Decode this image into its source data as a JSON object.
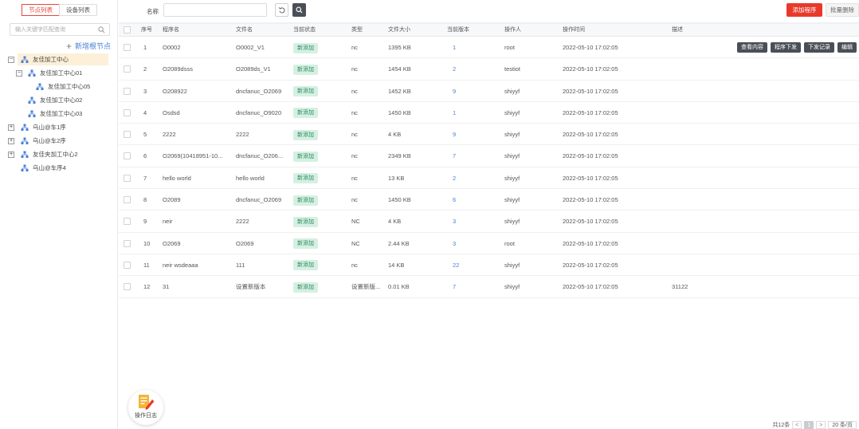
{
  "sidebar": {
    "tabs": [
      {
        "label": "节点列表",
        "active": true
      },
      {
        "label": "设备列表",
        "active": false
      }
    ],
    "search_placeholder": "输入关键字匹配查询",
    "add_root_label": "新增根节点",
    "tree": [
      {
        "label": "友佳加工中心",
        "toggle": "−",
        "selected": true
      },
      {
        "label": "友佳加工中心01",
        "toggle": "−"
      },
      {
        "label": "友佳加工中心05",
        "toggle": ""
      },
      {
        "label": "友佳加工中心02",
        "toggle": ""
      },
      {
        "label": "友佳加工中心03",
        "toggle": ""
      },
      {
        "label": "乌山@车1序",
        "toggle": "+"
      },
      {
        "label": "乌山@车2序",
        "toggle": "+"
      },
      {
        "label": "友佳夹加工中心2",
        "toggle": "+"
      },
      {
        "label": "乌山@车序4",
        "toggle": ""
      }
    ]
  },
  "toolbar": {
    "name_label": "名称",
    "name_value": "",
    "add_label": "添加程序",
    "batch_delete_label": "批量删除"
  },
  "table": {
    "headers": [
      "序号",
      "程序名",
      "文件名",
      "当前状态",
      "类型",
      "文件大小",
      "当前版本",
      "操作人",
      "操作时间",
      "描述"
    ],
    "row_actions": [
      "查看内容",
      "程序下发",
      "下发记录",
      "编辑"
    ],
    "rows": [
      {
        "no": "1",
        "program": "O0002",
        "file": "O0002_V1",
        "status": "新添加",
        "type": "nc",
        "size": "1395 KB",
        "version": "1",
        "operator": "root",
        "time": "2022-05-10 17:02:05",
        "desc": ""
      },
      {
        "no": "2",
        "program": "O2089dsss",
        "file": "O2089ds_V1",
        "status": "新添加",
        "type": "nc",
        "size": "1454 KB",
        "version": "2",
        "operator": "testiot",
        "time": "2022-05-10 17:02:05",
        "desc": ""
      },
      {
        "no": "3",
        "program": "O208922",
        "file": "dncfanuc_O2069",
        "status": "新添加",
        "type": "nc",
        "size": "1452 KB",
        "version": "9",
        "operator": "shiyyf",
        "time": "2022-05-10 17:02:05",
        "desc": ""
      },
      {
        "no": "4",
        "program": "Osdsd",
        "file": "dncfanuc_O9020",
        "status": "新添加",
        "type": "nc",
        "size": "1450 KB",
        "version": "1",
        "operator": "shiyyf",
        "time": "2022-05-10 17:02:05",
        "desc": ""
      },
      {
        "no": "5",
        "program": "2222",
        "file": "2222",
        "status": "新添加",
        "type": "nc",
        "size": "4 KB",
        "version": "9",
        "operator": "shiyyf",
        "time": "2022-05-10 17:02:05",
        "desc": ""
      },
      {
        "no": "6",
        "program": "O2069(10418951-10...",
        "file": "dncfanuc_O206...",
        "status": "新添加",
        "type": "nc",
        "size": "2349 KB",
        "version": "7",
        "operator": "shiyyf",
        "time": "2022-05-10 17:02:05",
        "desc": ""
      },
      {
        "no": "7",
        "program": "hello world",
        "file": "hello world",
        "status": "新添加",
        "type": "nc",
        "size": "13 KB",
        "version": "2",
        "operator": "shiyyf",
        "time": "2022-05-10 17:02:05",
        "desc": ""
      },
      {
        "no": "8",
        "program": "O2089",
        "file": "dncfanuc_O2069",
        "status": "新添加",
        "type": "nc",
        "size": "1450 KB",
        "version": "6",
        "operator": "shiyyf",
        "time": "2022-05-10 17:02:05",
        "desc": ""
      },
      {
        "no": "9",
        "program": "neir",
        "file": "2222",
        "status": "新添加",
        "type": "NC",
        "size": "4 KB",
        "version": "3",
        "operator": "shiyyf",
        "time": "2022-05-10 17:02:05",
        "desc": ""
      },
      {
        "no": "10",
        "program": "O2069",
        "file": "O2069",
        "status": "新添加",
        "type": "NC",
        "size": "2.44 KB",
        "version": "3",
        "operator": "root",
        "time": "2022-05-10 17:02:05",
        "desc": ""
      },
      {
        "no": "11",
        "program": "neir wsdeaaa",
        "file": "111",
        "status": "新添加",
        "type": "nc",
        "size": "14 KB",
        "version": "22",
        "operator": "shiyyf",
        "time": "2022-05-10 17:02:05",
        "desc": ""
      },
      {
        "no": "12",
        "program": "31",
        "file": "设置新版本",
        "status": "新添加",
        "type": "设置新版...",
        "size": "0.01 KB",
        "version": "7",
        "operator": "shiyyf",
        "time": "2022-05-10 17:02:05",
        "desc": "31122"
      }
    ]
  },
  "log_button": {
    "label": "操作日志",
    "icon": "document-pen-icon"
  },
  "pagination": {
    "total": "共12条",
    "prev": "<",
    "current": "1",
    "next": ">",
    "page_size": "20 条/页"
  },
  "colors": {
    "primary_red": "#e8392b",
    "dark_button": "#4a4f57",
    "link_blue": "#4a7fd8",
    "badge_bg": "#d5f0e3",
    "badge_text": "#2a8a5b"
  }
}
